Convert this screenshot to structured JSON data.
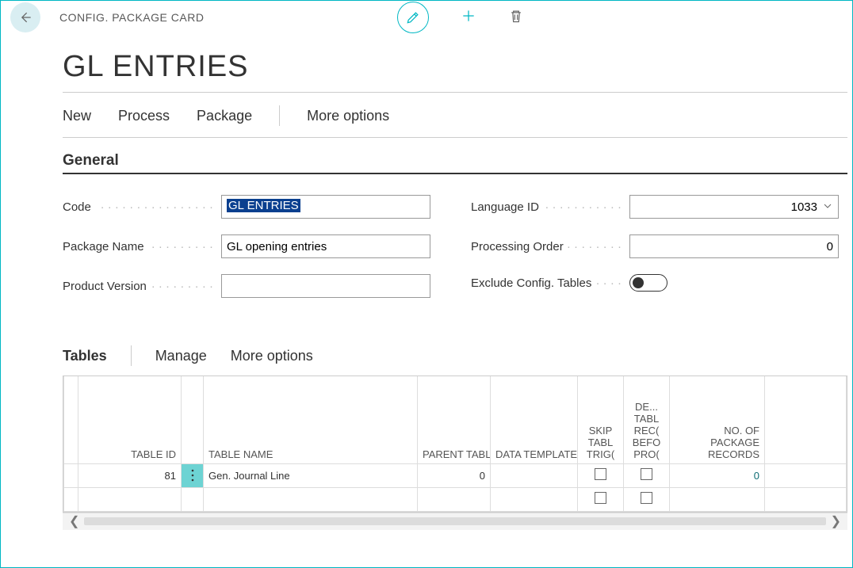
{
  "breadcrumb": "CONFIG. PACKAGE CARD",
  "page_title": "GL ENTRIES",
  "actions": {
    "new": "New",
    "process": "Process",
    "package": "Package",
    "more": "More options"
  },
  "fasttabs": {
    "general": "General"
  },
  "fields": {
    "code_label": "Code",
    "code_value": "GL ENTRIES",
    "pkgname_label": "Package Name",
    "pkgname_value": "GL opening entries",
    "prodver_label": "Product Version",
    "prodver_value": "",
    "lang_label": "Language ID",
    "lang_value": "1033",
    "procorder_label": "Processing Order",
    "procorder_value": "0",
    "exclude_label": "Exclude Config. Tables"
  },
  "subtab": {
    "tables": "Tables",
    "manage": "Manage",
    "more": "More options"
  },
  "grid": {
    "headers": {
      "table_id": "TABLE ID",
      "table_name": "TABLE NAME",
      "parent_id": "PARENT TABLE ID",
      "data_template": "DATA TEMPLATE",
      "skip": "SKIP TABL TRIG(",
      "delrecs": "DE... TABL REC( BEFO PRO(",
      "pkgrecs": "NO. OF PACKAGE RECORDS"
    },
    "rows": [
      {
        "table_id": "81",
        "table_name": "Gen. Journal Line",
        "parent_id": "0",
        "data_template": "",
        "skip": false,
        "delrecs": false,
        "pkgrecs": "0"
      },
      {
        "table_id": "",
        "table_name": "",
        "parent_id": "",
        "data_template": "",
        "skip": false,
        "delrecs": false,
        "pkgrecs": ""
      }
    ]
  },
  "icons": {
    "back": "back-arrow",
    "pencil": "pencil",
    "plus": "plus",
    "trash": "trash"
  },
  "colors": {
    "accent": "#00b7c3",
    "highlight": "#0a3f8f"
  }
}
